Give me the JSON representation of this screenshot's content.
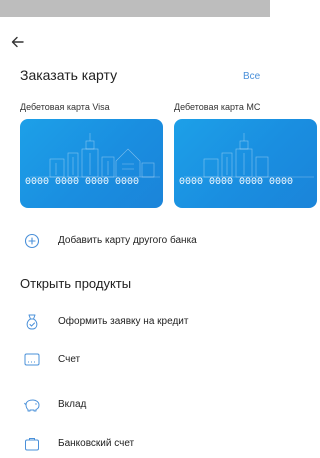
{
  "header": {
    "title": "Заказать карту",
    "all_label": "Все"
  },
  "cards": [
    {
      "label": "Дебетовая карта Visa",
      "number": "0000 0000 0000 0000"
    },
    {
      "label": "Дебетовая карта МС",
      "number": "0000 0000 0000 0000"
    }
  ],
  "add_card": {
    "label": "Добавить карту другого банка"
  },
  "products": {
    "title": "Открыть продукты",
    "items": [
      {
        "label": "Оформить заявку на кредит",
        "icon": "credit-request-icon"
      },
      {
        "label": "Счет",
        "icon": "account-icon"
      },
      {
        "label": "Вклад",
        "icon": "piggy-bank-icon"
      },
      {
        "label": "Банковский счет",
        "icon": "briefcase-icon"
      }
    ]
  },
  "colors": {
    "accent": "#4a90d9",
    "card": "#1b93e0"
  }
}
